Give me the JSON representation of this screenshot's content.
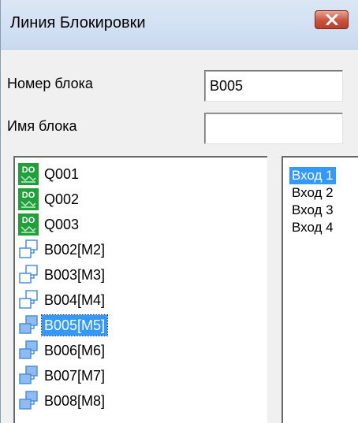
{
  "window": {
    "title": "Линия Блокировки"
  },
  "form": {
    "block_number_label": "Номер блока",
    "block_number_value": "B005",
    "block_name_label": "Имя блока",
    "block_name_value": ""
  },
  "tree": {
    "items": [
      {
        "label": "Q001",
        "icon": "do-output-icon",
        "selected": false
      },
      {
        "label": "Q002",
        "icon": "do-output-icon",
        "selected": false
      },
      {
        "label": "Q003",
        "icon": "do-output-icon",
        "selected": false
      },
      {
        "label": "B002[M2]",
        "icon": "block-outline-icon",
        "selected": false
      },
      {
        "label": "B003[M3]",
        "icon": "block-outline-icon",
        "selected": false
      },
      {
        "label": "B004[M4]",
        "icon": "block-outline-icon",
        "selected": false
      },
      {
        "label": "B005[M5]",
        "icon": "block-filled-icon",
        "selected": true
      },
      {
        "label": "B006[M6]",
        "icon": "block-filled-icon",
        "selected": false
      },
      {
        "label": "B007[M7]",
        "icon": "block-filled-icon",
        "selected": false
      },
      {
        "label": "B008[M8]",
        "icon": "block-filled-icon",
        "selected": false
      }
    ]
  },
  "inputs": {
    "items": [
      {
        "label": "Вход 1",
        "selected": true
      },
      {
        "label": "Вход 2",
        "selected": false
      },
      {
        "label": "Вход 3",
        "selected": false
      },
      {
        "label": "Вход 4",
        "selected": false
      }
    ]
  },
  "colors": {
    "selection": "#3399ff",
    "do_icon_green": "#1fa03a",
    "block_icon_blue": "#4a8fd8"
  }
}
